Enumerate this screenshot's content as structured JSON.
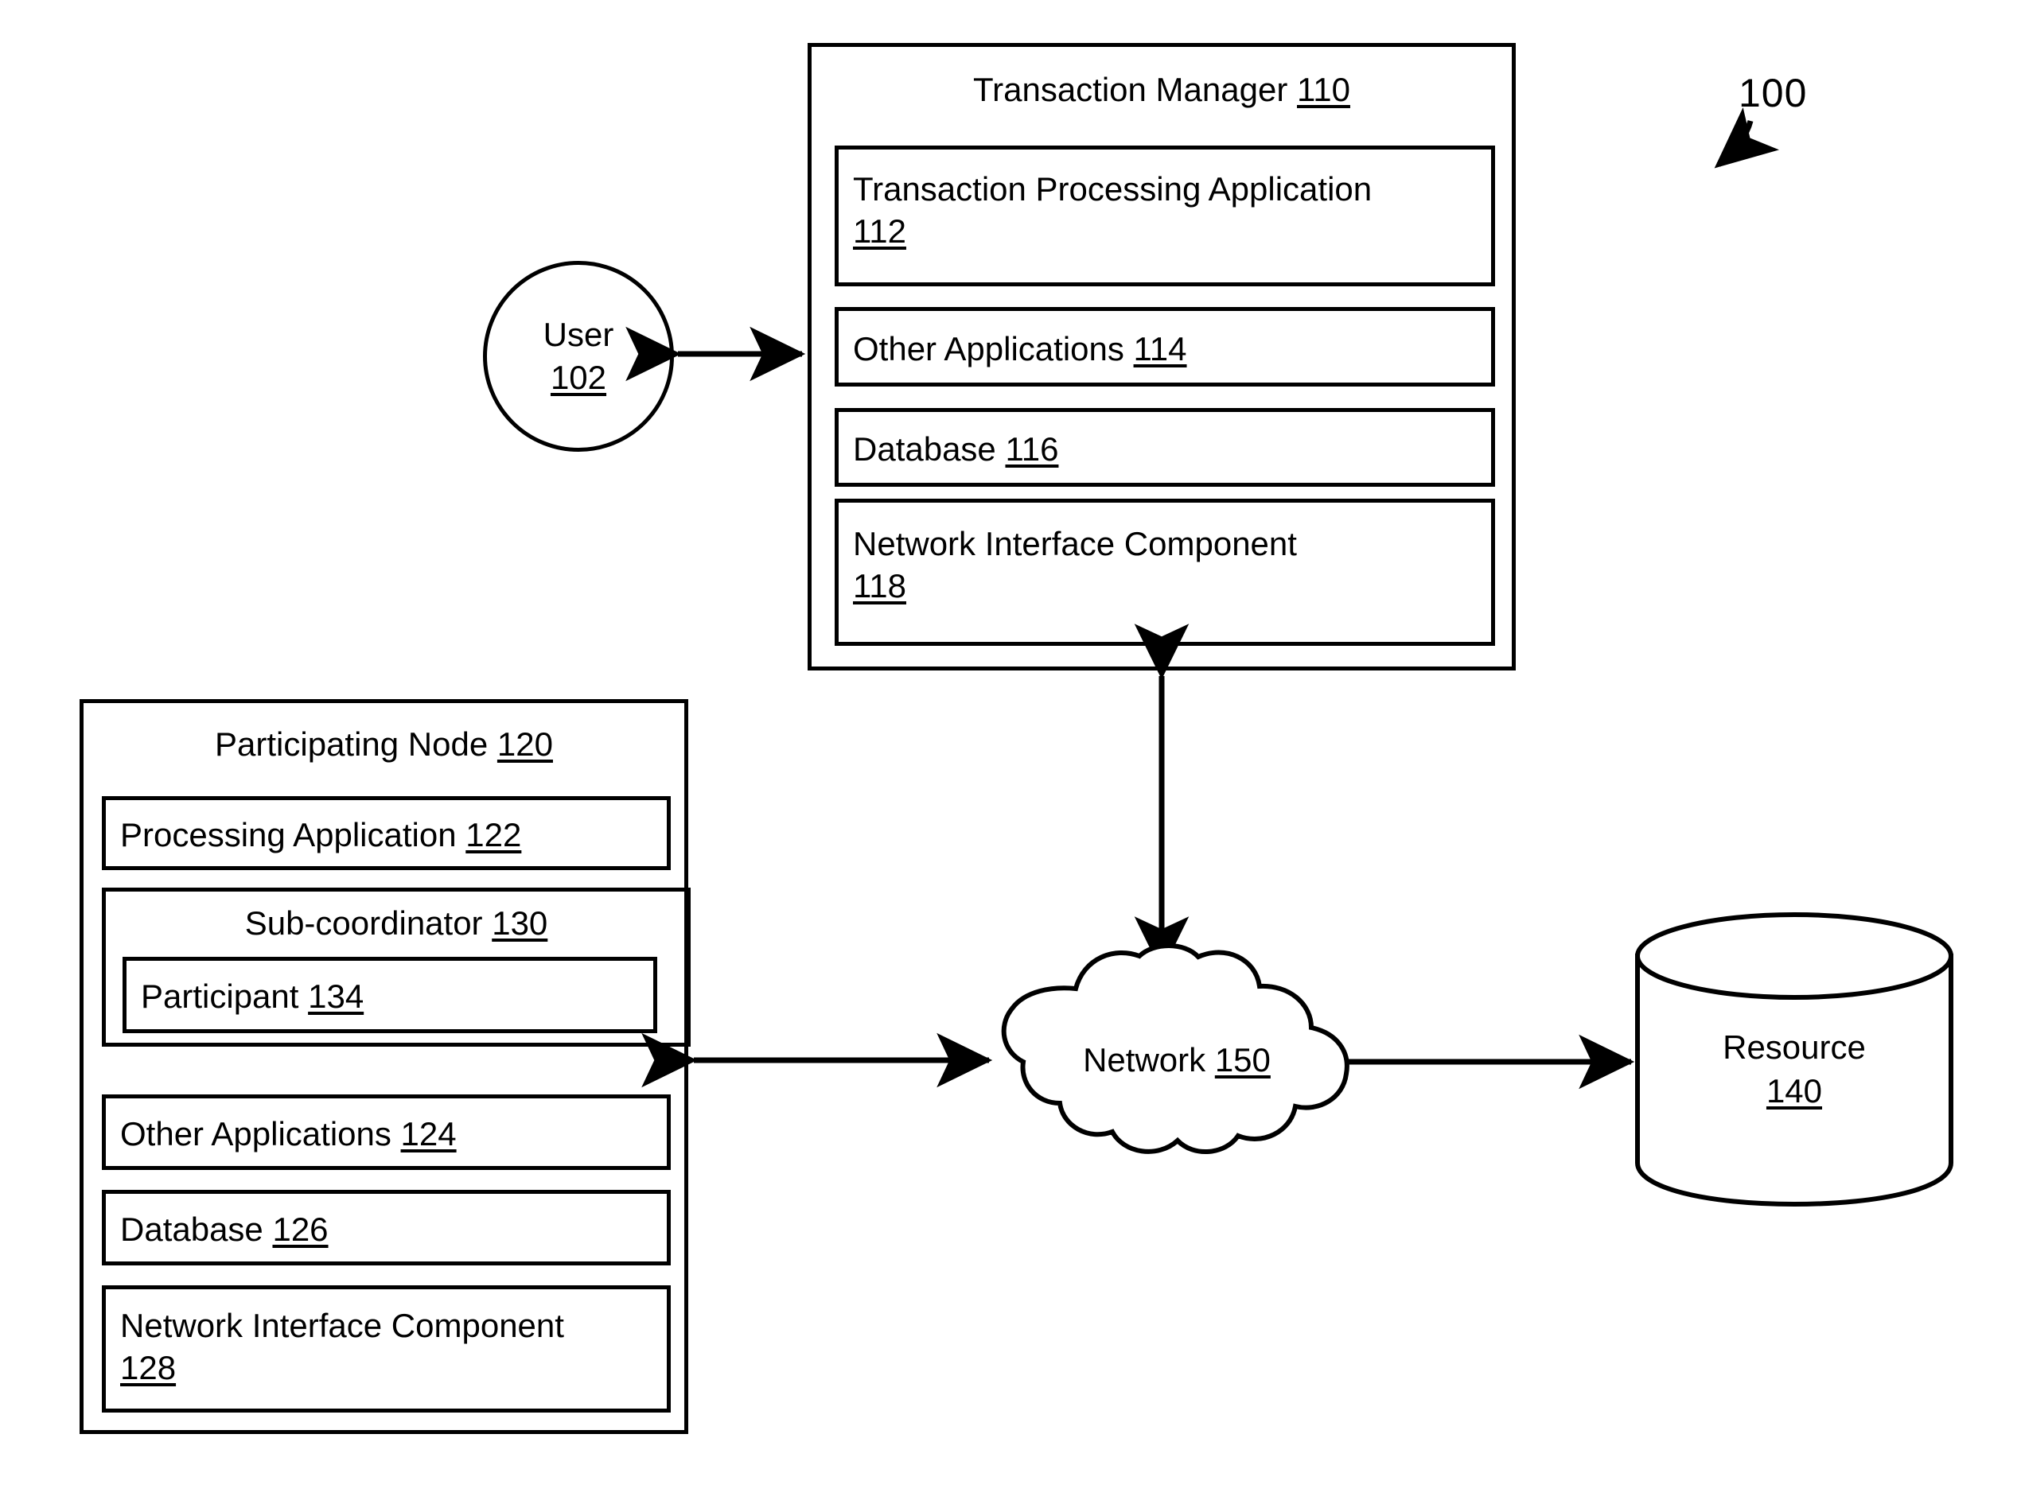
{
  "figure": {
    "number": "100",
    "type": "patent-system-block-diagram"
  },
  "user": {
    "label": "User",
    "ref": "102"
  },
  "transaction_manager": {
    "title_label": "Transaction Manager",
    "title_ref": "110",
    "components": [
      {
        "label": "Transaction Processing Application",
        "ref": "112"
      },
      {
        "label": "Other Applications",
        "ref": "114"
      },
      {
        "label": "Database",
        "ref": "116"
      },
      {
        "label": "Network Interface Component",
        "ref": "118"
      }
    ]
  },
  "participating_node": {
    "title_label": "Participating Node",
    "title_ref": "120",
    "processing_application": {
      "label": "Processing Application",
      "ref": "122"
    },
    "sub_coordinator": {
      "label": "Sub-coordinator",
      "ref": "130",
      "participant": {
        "label": "Participant",
        "ref": "134"
      }
    },
    "components": [
      {
        "label": "Other Applications",
        "ref": "124"
      },
      {
        "label": "Database",
        "ref": "126"
      },
      {
        "label": "Network Interface Component",
        "ref": "128"
      }
    ]
  },
  "network": {
    "label": "Network",
    "ref": "150"
  },
  "resource": {
    "label": "Resource",
    "ref": "140"
  },
  "connections": [
    {
      "from": "user",
      "to": "transaction_manager",
      "style": "double-arrow-horizontal"
    },
    {
      "from": "transaction_manager",
      "to": "network",
      "style": "double-arrow-vertical"
    },
    {
      "from": "participating_node",
      "to": "network",
      "style": "double-arrow-horizontal"
    },
    {
      "from": "network",
      "to": "resource",
      "style": "double-arrow-horizontal"
    }
  ],
  "colors": {
    "stroke": "#000000",
    "background": "#ffffff"
  }
}
